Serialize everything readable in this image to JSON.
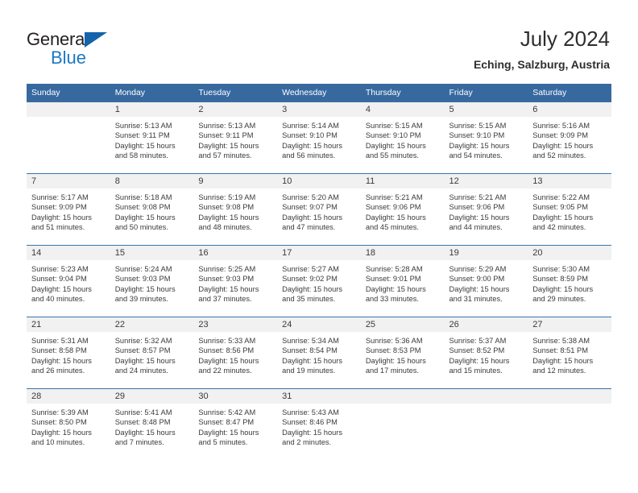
{
  "brand": {
    "name_part1": "General",
    "name_part2": "Blue",
    "triangle_icon": "triangle-icon",
    "colors": {
      "dark": "#231f20",
      "blue": "#1b79c4",
      "triangle": "#1463ab"
    }
  },
  "header": {
    "title": "July 2024",
    "location": "Eching, Salzburg, Austria"
  },
  "theme": {
    "header_blue": "#37699f",
    "row_divider_blue": "#3b73ab",
    "daynum_bg": "#f1f1f1",
    "text": "#3a3a3a"
  },
  "weekdays": [
    "Sunday",
    "Monday",
    "Tuesday",
    "Wednesday",
    "Thursday",
    "Friday",
    "Saturday"
  ],
  "weeks": [
    [
      {
        "day": "",
        "sunrise": "",
        "sunset": "",
        "daylight_line1": "",
        "daylight_line2": ""
      },
      {
        "day": "1",
        "sunrise": "Sunrise: 5:13 AM",
        "sunset": "Sunset: 9:11 PM",
        "daylight_line1": "Daylight: 15 hours",
        "daylight_line2": "and 58 minutes."
      },
      {
        "day": "2",
        "sunrise": "Sunrise: 5:13 AM",
        "sunset": "Sunset: 9:11 PM",
        "daylight_line1": "Daylight: 15 hours",
        "daylight_line2": "and 57 minutes."
      },
      {
        "day": "3",
        "sunrise": "Sunrise: 5:14 AM",
        "sunset": "Sunset: 9:10 PM",
        "daylight_line1": "Daylight: 15 hours",
        "daylight_line2": "and 56 minutes."
      },
      {
        "day": "4",
        "sunrise": "Sunrise: 5:15 AM",
        "sunset": "Sunset: 9:10 PM",
        "daylight_line1": "Daylight: 15 hours",
        "daylight_line2": "and 55 minutes."
      },
      {
        "day": "5",
        "sunrise": "Sunrise: 5:15 AM",
        "sunset": "Sunset: 9:10 PM",
        "daylight_line1": "Daylight: 15 hours",
        "daylight_line2": "and 54 minutes."
      },
      {
        "day": "6",
        "sunrise": "Sunrise: 5:16 AM",
        "sunset": "Sunset: 9:09 PM",
        "daylight_line1": "Daylight: 15 hours",
        "daylight_line2": "and 52 minutes."
      }
    ],
    [
      {
        "day": "7",
        "sunrise": "Sunrise: 5:17 AM",
        "sunset": "Sunset: 9:09 PM",
        "daylight_line1": "Daylight: 15 hours",
        "daylight_line2": "and 51 minutes."
      },
      {
        "day": "8",
        "sunrise": "Sunrise: 5:18 AM",
        "sunset": "Sunset: 9:08 PM",
        "daylight_line1": "Daylight: 15 hours",
        "daylight_line2": "and 50 minutes."
      },
      {
        "day": "9",
        "sunrise": "Sunrise: 5:19 AM",
        "sunset": "Sunset: 9:08 PM",
        "daylight_line1": "Daylight: 15 hours",
        "daylight_line2": "and 48 minutes."
      },
      {
        "day": "10",
        "sunrise": "Sunrise: 5:20 AM",
        "sunset": "Sunset: 9:07 PM",
        "daylight_line1": "Daylight: 15 hours",
        "daylight_line2": "and 47 minutes."
      },
      {
        "day": "11",
        "sunrise": "Sunrise: 5:21 AM",
        "sunset": "Sunset: 9:06 PM",
        "daylight_line1": "Daylight: 15 hours",
        "daylight_line2": "and 45 minutes."
      },
      {
        "day": "12",
        "sunrise": "Sunrise: 5:21 AM",
        "sunset": "Sunset: 9:06 PM",
        "daylight_line1": "Daylight: 15 hours",
        "daylight_line2": "and 44 minutes."
      },
      {
        "day": "13",
        "sunrise": "Sunrise: 5:22 AM",
        "sunset": "Sunset: 9:05 PM",
        "daylight_line1": "Daylight: 15 hours",
        "daylight_line2": "and 42 minutes."
      }
    ],
    [
      {
        "day": "14",
        "sunrise": "Sunrise: 5:23 AM",
        "sunset": "Sunset: 9:04 PM",
        "daylight_line1": "Daylight: 15 hours",
        "daylight_line2": "and 40 minutes."
      },
      {
        "day": "15",
        "sunrise": "Sunrise: 5:24 AM",
        "sunset": "Sunset: 9:03 PM",
        "daylight_line1": "Daylight: 15 hours",
        "daylight_line2": "and 39 minutes."
      },
      {
        "day": "16",
        "sunrise": "Sunrise: 5:25 AM",
        "sunset": "Sunset: 9:03 PM",
        "daylight_line1": "Daylight: 15 hours",
        "daylight_line2": "and 37 minutes."
      },
      {
        "day": "17",
        "sunrise": "Sunrise: 5:27 AM",
        "sunset": "Sunset: 9:02 PM",
        "daylight_line1": "Daylight: 15 hours",
        "daylight_line2": "and 35 minutes."
      },
      {
        "day": "18",
        "sunrise": "Sunrise: 5:28 AM",
        "sunset": "Sunset: 9:01 PM",
        "daylight_line1": "Daylight: 15 hours",
        "daylight_line2": "and 33 minutes."
      },
      {
        "day": "19",
        "sunrise": "Sunrise: 5:29 AM",
        "sunset": "Sunset: 9:00 PM",
        "daylight_line1": "Daylight: 15 hours",
        "daylight_line2": "and 31 minutes."
      },
      {
        "day": "20",
        "sunrise": "Sunrise: 5:30 AM",
        "sunset": "Sunset: 8:59 PM",
        "daylight_line1": "Daylight: 15 hours",
        "daylight_line2": "and 29 minutes."
      }
    ],
    [
      {
        "day": "21",
        "sunrise": "Sunrise: 5:31 AM",
        "sunset": "Sunset: 8:58 PM",
        "daylight_line1": "Daylight: 15 hours",
        "daylight_line2": "and 26 minutes."
      },
      {
        "day": "22",
        "sunrise": "Sunrise: 5:32 AM",
        "sunset": "Sunset: 8:57 PM",
        "daylight_line1": "Daylight: 15 hours",
        "daylight_line2": "and 24 minutes."
      },
      {
        "day": "23",
        "sunrise": "Sunrise: 5:33 AM",
        "sunset": "Sunset: 8:56 PM",
        "daylight_line1": "Daylight: 15 hours",
        "daylight_line2": "and 22 minutes."
      },
      {
        "day": "24",
        "sunrise": "Sunrise: 5:34 AM",
        "sunset": "Sunset: 8:54 PM",
        "daylight_line1": "Daylight: 15 hours",
        "daylight_line2": "and 19 minutes."
      },
      {
        "day": "25",
        "sunrise": "Sunrise: 5:36 AM",
        "sunset": "Sunset: 8:53 PM",
        "daylight_line1": "Daylight: 15 hours",
        "daylight_line2": "and 17 minutes."
      },
      {
        "day": "26",
        "sunrise": "Sunrise: 5:37 AM",
        "sunset": "Sunset: 8:52 PM",
        "daylight_line1": "Daylight: 15 hours",
        "daylight_line2": "and 15 minutes."
      },
      {
        "day": "27",
        "sunrise": "Sunrise: 5:38 AM",
        "sunset": "Sunset: 8:51 PM",
        "daylight_line1": "Daylight: 15 hours",
        "daylight_line2": "and 12 minutes."
      }
    ],
    [
      {
        "day": "28",
        "sunrise": "Sunrise: 5:39 AM",
        "sunset": "Sunset: 8:50 PM",
        "daylight_line1": "Daylight: 15 hours",
        "daylight_line2": "and 10 minutes."
      },
      {
        "day": "29",
        "sunrise": "Sunrise: 5:41 AM",
        "sunset": "Sunset: 8:48 PM",
        "daylight_line1": "Daylight: 15 hours",
        "daylight_line2": "and 7 minutes."
      },
      {
        "day": "30",
        "sunrise": "Sunrise: 5:42 AM",
        "sunset": "Sunset: 8:47 PM",
        "daylight_line1": "Daylight: 15 hours",
        "daylight_line2": "and 5 minutes."
      },
      {
        "day": "31",
        "sunrise": "Sunrise: 5:43 AM",
        "sunset": "Sunset: 8:46 PM",
        "daylight_line1": "Daylight: 15 hours",
        "daylight_line2": "and 2 minutes."
      },
      {
        "day": "",
        "sunrise": "",
        "sunset": "",
        "daylight_line1": "",
        "daylight_line2": ""
      },
      {
        "day": "",
        "sunrise": "",
        "sunset": "",
        "daylight_line1": "",
        "daylight_line2": ""
      },
      {
        "day": "",
        "sunrise": "",
        "sunset": "",
        "daylight_line1": "",
        "daylight_line2": ""
      }
    ]
  ]
}
